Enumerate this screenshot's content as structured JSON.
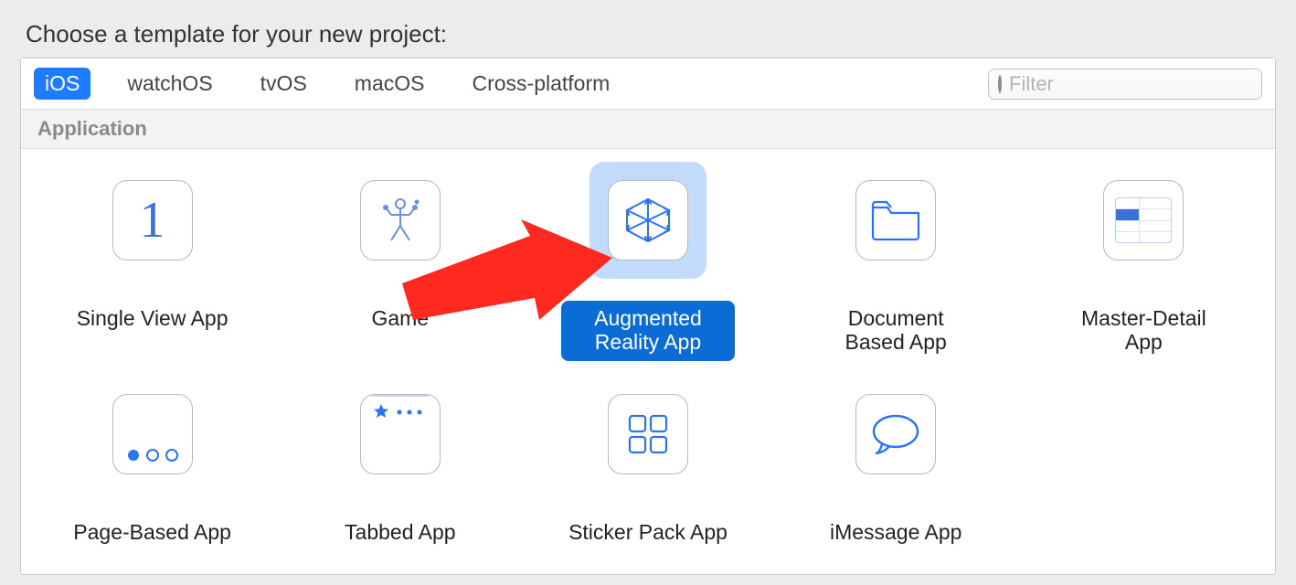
{
  "header": {
    "title": "Choose a template for your new project:"
  },
  "toolbar": {
    "tabs": [
      {
        "label": "iOS",
        "selected": true
      },
      {
        "label": "watchOS",
        "selected": false
      },
      {
        "label": "tvOS",
        "selected": false
      },
      {
        "label": "macOS",
        "selected": false
      },
      {
        "label": "Cross-platform",
        "selected": false
      }
    ],
    "filter_placeholder": "Filter"
  },
  "section": {
    "title": "Application"
  },
  "templates": [
    {
      "label": "Single View App",
      "icon": "single-view",
      "selected": false
    },
    {
      "label": "Game",
      "icon": "game",
      "selected": false
    },
    {
      "label": "Augmented Reality App",
      "icon": "ar",
      "selected": true
    },
    {
      "label": "Document Based App",
      "icon": "document",
      "selected": false
    },
    {
      "label": "Master-Detail App",
      "icon": "master-detail",
      "selected": false
    },
    {
      "label": "Page-Based App",
      "icon": "page-based",
      "selected": false
    },
    {
      "label": "Tabbed App",
      "icon": "tabbed",
      "selected": false
    },
    {
      "label": "Sticker Pack App",
      "icon": "sticker-pack",
      "selected": false
    },
    {
      "label": "iMessage App",
      "icon": "imessage",
      "selected": false
    }
  ],
  "annotation": {
    "arrow_points_to": "Augmented Reality App",
    "color": "#ff2a1f"
  }
}
